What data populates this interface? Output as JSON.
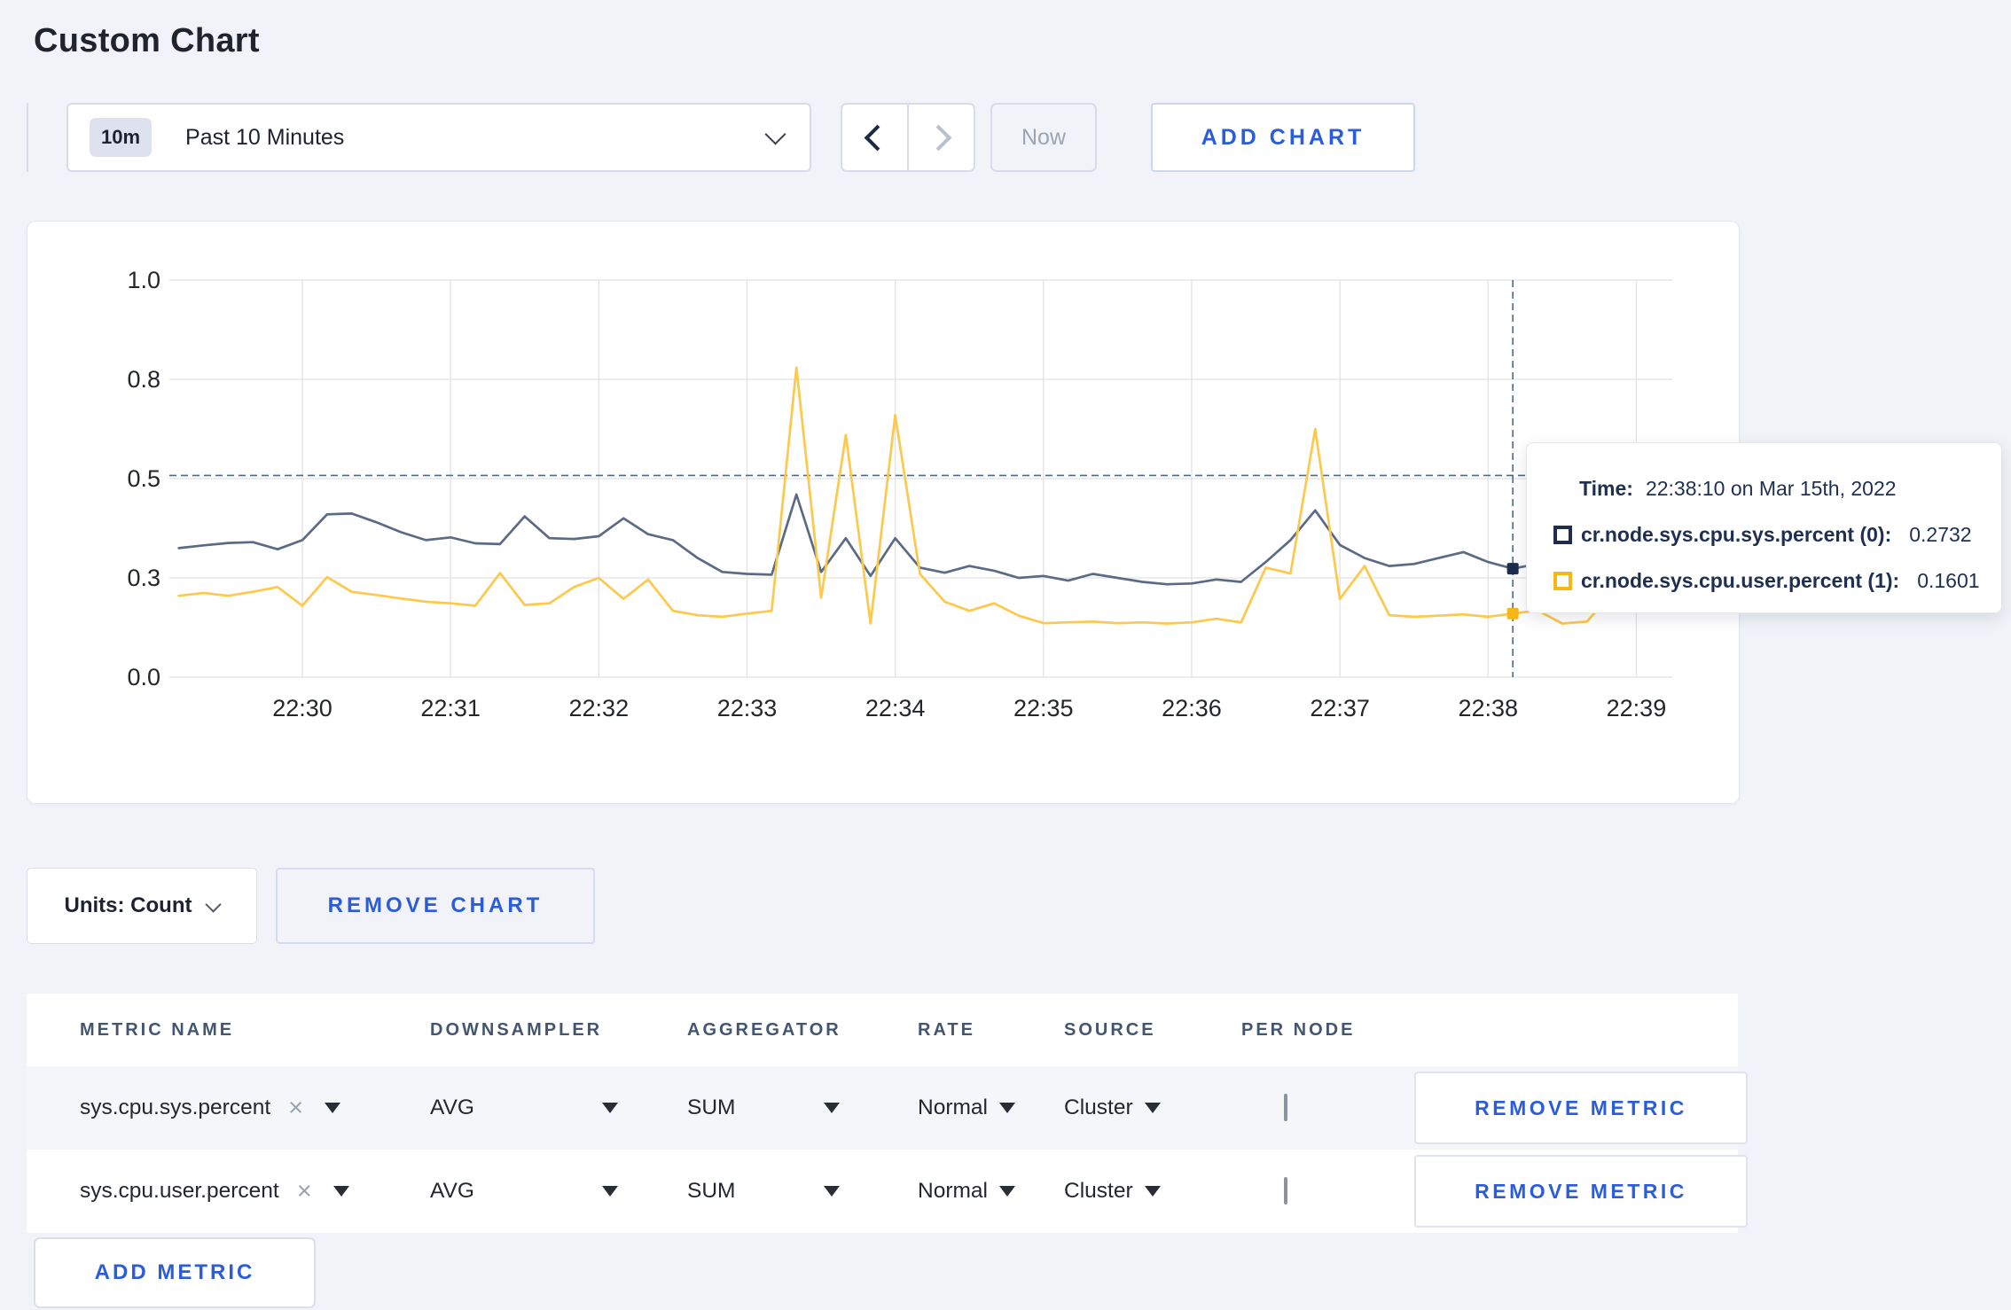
{
  "page": {
    "title": "Custom Chart"
  },
  "toolbar": {
    "time_range": {
      "badge": "10m",
      "label": "Past 10 Minutes"
    },
    "now_label": "Now",
    "add_chart_label": "ADD CHART"
  },
  "units": {
    "label": "Units: Count"
  },
  "remove_chart_label": "REMOVE CHART",
  "tooltip": {
    "time_label": "Time:",
    "time_value": "22:38:10 on Mar 15th, 2022",
    "rows": [
      {
        "label": "cr.node.sys.cpu.sys.percent (0):",
        "value": "0.2732"
      },
      {
        "label": "cr.node.sys.cpu.user.percent (1):",
        "value": "0.1601"
      }
    ]
  },
  "metrics_table": {
    "headers": [
      "METRIC NAME",
      "DOWNSAMPLER",
      "AGGREGATOR",
      "RATE",
      "SOURCE",
      "PER NODE"
    ],
    "rows": [
      {
        "metric": "sys.cpu.sys.percent",
        "remove_icon": "×",
        "downsampler": "AVG",
        "aggregator": "SUM",
        "rate": "Normal",
        "source": "Cluster",
        "per_node_checked": false,
        "remove_label": "REMOVE METRIC"
      },
      {
        "metric": "sys.cpu.user.percent",
        "remove_icon": "×",
        "downsampler": "AVG",
        "aggregator": "SUM",
        "rate": "Normal",
        "source": "Cluster",
        "per_node_checked": false,
        "remove_label": "REMOVE METRIC"
      }
    ],
    "add_metric_label": "ADD METRIC"
  },
  "chart_data": {
    "type": "line",
    "title": "",
    "xlabel": "",
    "ylabel": "",
    "ylim": [
      0,
      1
    ],
    "grid": true,
    "legend_position": "tooltip",
    "x": [
      "22:29:10",
      "22:29:20",
      "22:29:30",
      "22:29:40",
      "22:29:50",
      "22:30:00",
      "22:30:10",
      "22:30:20",
      "22:30:30",
      "22:30:40",
      "22:30:50",
      "22:31:00",
      "22:31:10",
      "22:31:20",
      "22:31:30",
      "22:31:40",
      "22:31:50",
      "22:32:00",
      "22:32:10",
      "22:32:20",
      "22:32:30",
      "22:32:40",
      "22:32:50",
      "22:33:00",
      "22:33:10",
      "22:33:20",
      "22:33:30",
      "22:33:40",
      "22:33:50",
      "22:34:00",
      "22:34:10",
      "22:34:20",
      "22:34:30",
      "22:34:40",
      "22:34:50",
      "22:35:00",
      "22:35:10",
      "22:35:20",
      "22:35:30",
      "22:35:40",
      "22:35:50",
      "22:36:00",
      "22:36:10",
      "22:36:20",
      "22:36:30",
      "22:36:40",
      "22:36:50",
      "22:37:00",
      "22:37:10",
      "22:37:20",
      "22:37:30",
      "22:37:40",
      "22:37:50",
      "22:38:00",
      "22:38:10",
      "22:38:20",
      "22:38:30",
      "22:38:40",
      "22:38:50",
      "22:39:00",
      "22:39:10"
    ],
    "x_ticks": [
      "22:30",
      "22:31",
      "22:32",
      "22:33",
      "22:34",
      "22:35",
      "22:36",
      "22:37",
      "22:38",
      "22:39"
    ],
    "y_ticks": [
      {
        "value": 0,
        "label": "0.0"
      },
      {
        "value": 0.25,
        "label": "0.3"
      },
      {
        "value": 0.5,
        "label": "0.5"
      },
      {
        "value": 0.75,
        "label": "0.8"
      },
      {
        "value": 1,
        "label": "1.0"
      }
    ],
    "series": [
      {
        "name": "cr.node.sys.cpu.sys.percent (0)",
        "line_color": "#5b6a85",
        "swatch_color": "#1f2d4d",
        "values": [
          0.325,
          0.332,
          0.338,
          0.34,
          0.322,
          0.345,
          0.41,
          0.412,
          0.39,
          0.365,
          0.345,
          0.352,
          0.337,
          0.335,
          0.405,
          0.35,
          0.348,
          0.355,
          0.4,
          0.36,
          0.345,
          0.3,
          0.265,
          0.26,
          0.258,
          0.46,
          0.265,
          0.35,
          0.255,
          0.35,
          0.276,
          0.263,
          0.28,
          0.268,
          0.25,
          0.255,
          0.243,
          0.26,
          0.25,
          0.24,
          0.234,
          0.236,
          0.246,
          0.24,
          0.29,
          0.345,
          0.42,
          0.333,
          0.3,
          0.28,
          0.285,
          0.3,
          0.315,
          0.29,
          0.2732,
          0.285,
          0.27,
          0.272,
          0.28,
          0.275,
          0.28
        ]
      },
      {
        "name": "cr.node.sys.cpu.user.percent (1)",
        "line_color": "#fdc84b",
        "swatch_color": "#f5b816",
        "values": [
          0.205,
          0.212,
          0.205,
          0.215,
          0.227,
          0.18,
          0.252,
          0.215,
          0.207,
          0.198,
          0.19,
          0.186,
          0.18,
          0.262,
          0.182,
          0.186,
          0.227,
          0.25,
          0.197,
          0.246,
          0.167,
          0.156,
          0.152,
          0.16,
          0.167,
          0.78,
          0.2,
          0.61,
          0.135,
          0.66,
          0.26,
          0.19,
          0.167,
          0.186,
          0.155,
          0.136,
          0.138,
          0.14,
          0.136,
          0.138,
          0.135,
          0.138,
          0.147,
          0.138,
          0.276,
          0.261,
          0.625,
          0.197,
          0.28,
          0.156,
          0.152,
          0.155,
          0.158,
          0.152,
          0.1601,
          0.168,
          0.135,
          0.14,
          0.21,
          0.31,
          0.24
        ]
      }
    ],
    "crosshair": {
      "time": "22:38:10",
      "value": 0.508,
      "color": "#4a6a85"
    },
    "markers": [
      {
        "series": 0,
        "time": "22:38:10",
        "value": 0.2732
      },
      {
        "series": 1,
        "time": "22:38:10",
        "value": 0.1601
      }
    ]
  }
}
